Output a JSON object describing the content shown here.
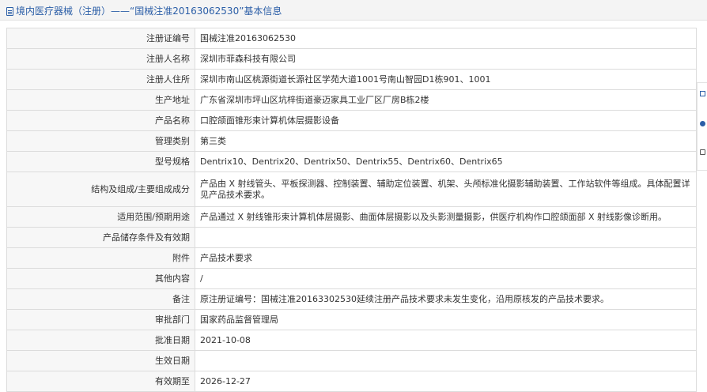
{
  "header": {
    "title": "境内医疗器械（注册）——“国械注准20163062530”基本信息"
  },
  "rows": [
    {
      "label": "注册证编号",
      "value": "国械注准20163062530"
    },
    {
      "label": "注册人名称",
      "value": "深圳市菲森科技有限公司"
    },
    {
      "label": "注册人住所",
      "value": "深圳市南山区桃源街道长源社区学苑大道1001号南山智园D1栋901、1001"
    },
    {
      "label": "生产地址",
      "value": "广东省深圳市坪山区坑梓街道豪迈家具工业厂区厂房B栋2楼"
    },
    {
      "label": "产品名称",
      "value": "口腔颌面锥形束计算机体层摄影设备"
    },
    {
      "label": "管理类别",
      "value": "第三类"
    },
    {
      "label": "型号规格",
      "value": "Dentrix10、Dentrix20、Dentrix50、Dentrix55、Dentrix60、Dentrix65"
    },
    {
      "label": "结构及组成/主要组成成分",
      "value": "产品由 X 射线管头、平板探测器、控制装置、辅助定位装置、机架、头颅标准化摄影辅助装置、工作站软件等组成。具体配置详见产品技术要求。"
    },
    {
      "label": "适用范围/预期用途",
      "value": "产品通过 X 射线锥形束计算机体层摄影、曲面体层摄影以及头影测量摄影，供医疗机构作口腔颌面部 X 射线影像诊断用。"
    },
    {
      "label": "产品储存条件及有效期",
      "value": ""
    },
    {
      "label": "附件",
      "value": "产品技术要求"
    },
    {
      "label": "其他内容",
      "value": "/"
    },
    {
      "label": "备注",
      "value": "原注册证编号：国械注准20163302530延续注册产品技术要求未发生变化，沿用原核发的产品技术要求。"
    },
    {
      "label": "审批部门",
      "value": "国家药品监督管理局"
    },
    {
      "label": "批准日期",
      "value": "2021-10-08"
    },
    {
      "label": "生效日期",
      "value": ""
    },
    {
      "label": "有效期至",
      "value": "2026-12-27"
    }
  ]
}
